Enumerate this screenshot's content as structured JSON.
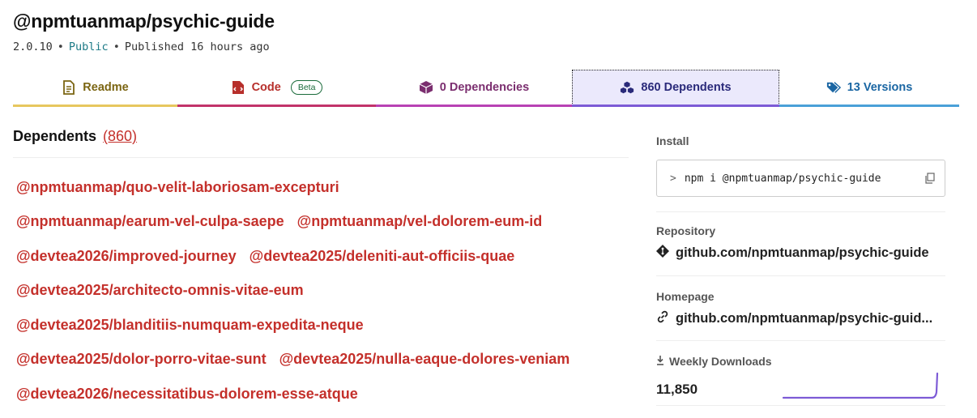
{
  "package": {
    "name": "@npmtuanmap/psychic-guide",
    "version": "2.0.10",
    "visibility": "Public",
    "published": "Published 16 hours ago"
  },
  "tabs": [
    {
      "label": "Readme",
      "icon": "readme-icon"
    },
    {
      "label": "Code",
      "icon": "code-icon",
      "badge": "Beta"
    },
    {
      "label": "0 Dependencies",
      "icon": "box-icon"
    },
    {
      "label": "860 Dependents",
      "icon": "boxes-icon"
    },
    {
      "label": "13 Versions",
      "icon": "tags-icon"
    }
  ],
  "dependents": {
    "heading": "Dependents",
    "count": "(860)",
    "rows": [
      [
        "@npmtuanmap/quo-velit-laboriosam-excepturi"
      ],
      [
        "@npmtuanmap/earum-vel-culpa-saepe",
        "@npmtuanmap/vel-dolorem-eum-id"
      ],
      [
        "@devtea2026/improved-journey",
        "@devtea2025/deleniti-aut-officiis-quae"
      ],
      [
        "@devtea2025/architecto-omnis-vitae-eum"
      ],
      [
        "@devtea2025/blanditiis-numquam-expedita-neque"
      ],
      [
        "@devtea2025/dolor-porro-vitae-sunt",
        "@devtea2025/nulla-eaque-dolores-veniam"
      ],
      [
        "@devtea2026/necessitatibus-dolorem-esse-atque"
      ]
    ]
  },
  "sidebar": {
    "install_label": "Install",
    "install_prompt": ">",
    "install_command": "npm i @npmtuanmap/psychic-guide",
    "repository_label": "Repository",
    "repository_url": "github.com/npmtuanmap/psychic-guide",
    "homepage_label": "Homepage",
    "homepage_url": "github.com/npmtuanmap/psychic-guid...",
    "downloads_label": "Weekly Downloads",
    "downloads_value": "11,850"
  },
  "colors": {
    "link": "#c4302b",
    "accent": "#7d5bd6",
    "readme": "#7b6512",
    "code": "#b72f2b",
    "deps": "#7b2e6f",
    "dependents": "#2a2a7a",
    "versions": "#1a66a3"
  }
}
